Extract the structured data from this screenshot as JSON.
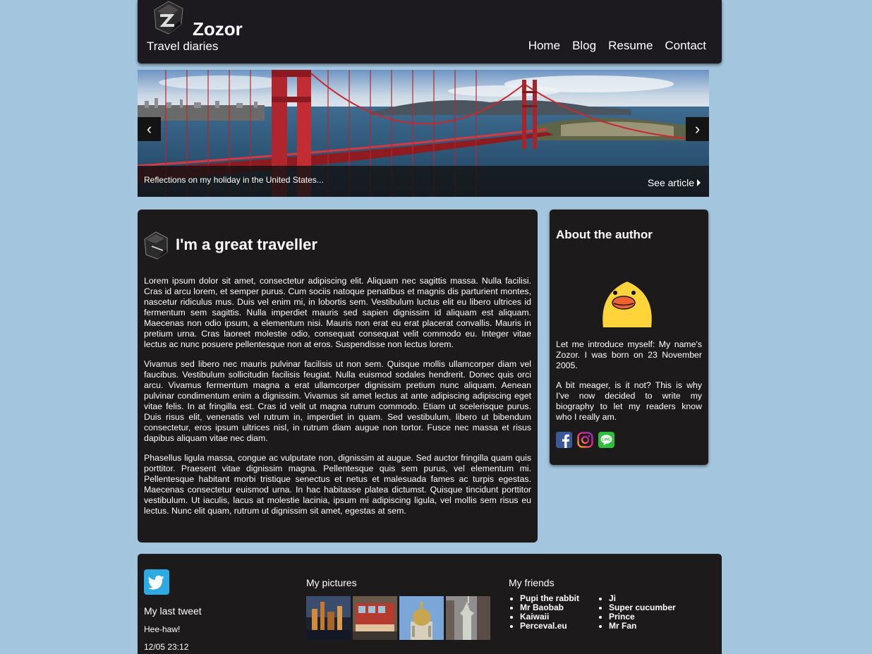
{
  "header": {
    "title": "Zozor",
    "tagline": "Travel diaries",
    "nav": [
      "Home",
      "Blog",
      "Resume",
      "Contact"
    ]
  },
  "banner": {
    "caption": "Reflections on my holiday in the United States...",
    "link_label": "See article",
    "prev_glyph": "‹",
    "next_glyph": "›"
  },
  "article": {
    "title": "I'm a great traveller",
    "paragraphs": [
      "Lorem ipsum dolor sit amet, consectetur adipiscing elit. Aliquam nec sagittis massa. Nulla facilisi. Cras id arcu lorem, et semper purus. Cum sociis natoque penatibus et magnis dis parturient montes, nascetur ridiculus mus. Duis vel enim mi, in lobortis sem. Vestibulum luctus elit eu libero ultrices id fermentum sem sagittis. Nulla imperdiet mauris sed sapien dignissim id aliquam est aliquam. Maecenas non odio ipsum, a elementum nisi. Mauris non erat eu erat placerat convallis. Mauris in pretium urna. Cras laoreet molestie odio, consequat consequat velit commodo eu. Integer vitae lectus ac nunc posuere pellentesque non at eros. Suspendisse non lectus lorem.",
      "Vivamus sed libero nec mauris pulvinar facilisis ut non sem. Quisque mollis ullamcorper diam vel faucibus. Vestibulum sollicitudin facilisis feugiat. Nulla euismod sodales hendrerit. Donec quis orci arcu. Vivamus fermentum magna a erat ullamcorper dignissim pretium nunc aliquam. Aenean pulvinar condimentum enim a dignissim. Vivamus sit amet lectus at ante adipiscing adipiscing eget vitae felis. In at fringilla est. Cras id velit ut magna rutrum commodo. Etiam ut scelerisque purus. Duis risus elit, venenatis vel rutrum in, imperdiet in quam. Sed vestibulum, libero ut bibendum consectetur, eros ipsum ultrices nisl, in rutrum diam augue non tortor. Fusce nec massa et risus dapibus aliquam vitae nec diam.",
      "Phasellus ligula massa, congue ac vulputate non, dignissim at augue. Sed auctor fringilla quam quis porttitor. Praesent vitae dignissim magna. Pellentesque quis sem purus, vel elementum mi. Pellentesque habitant morbi tristique senectus et netus et malesuada fames ac turpis egestas. Maecenas consectetur euismod urna. In hac habitasse platea dictumst. Quisque tincidunt porttitor vestibulum. Ut iaculis, lacus at molestie lacinia, ipsum mi adipiscing ligula, vel mollis sem risus eu lectus. Nunc elit quam, rutrum ut dignissim sit amet, egestas at sem."
    ]
  },
  "aside": {
    "title": "About the author",
    "paragraphs": [
      "Let me introduce myself: My name's Zozor. I was born on 23 November 2005.",
      "A bit meager, is it not? This is why I've now decided to write my biography to let my readers know who I really am."
    ],
    "socials": [
      "facebook-icon",
      "instagram-icon",
      "line-icon"
    ]
  },
  "footer": {
    "tweet_title": "My last tweet",
    "tweet_text": "Hee-haw!",
    "tweet_time": "12/05 23:12",
    "pictures_title": "My pictures",
    "friends_title": "My friends",
    "friends_col1": [
      "Pupi the rabbit",
      "Mr Baobab",
      "Kaiwaii",
      "Perceval.eu"
    ],
    "friends_col2": [
      "Ji",
      "Super cucumber",
      "Prince",
      "Mr Fan"
    ]
  },
  "colors": {
    "page_bg": "#a3c5de",
    "panel_bg": "#1c1a1a",
    "bridge_red": "#c0262d"
  }
}
